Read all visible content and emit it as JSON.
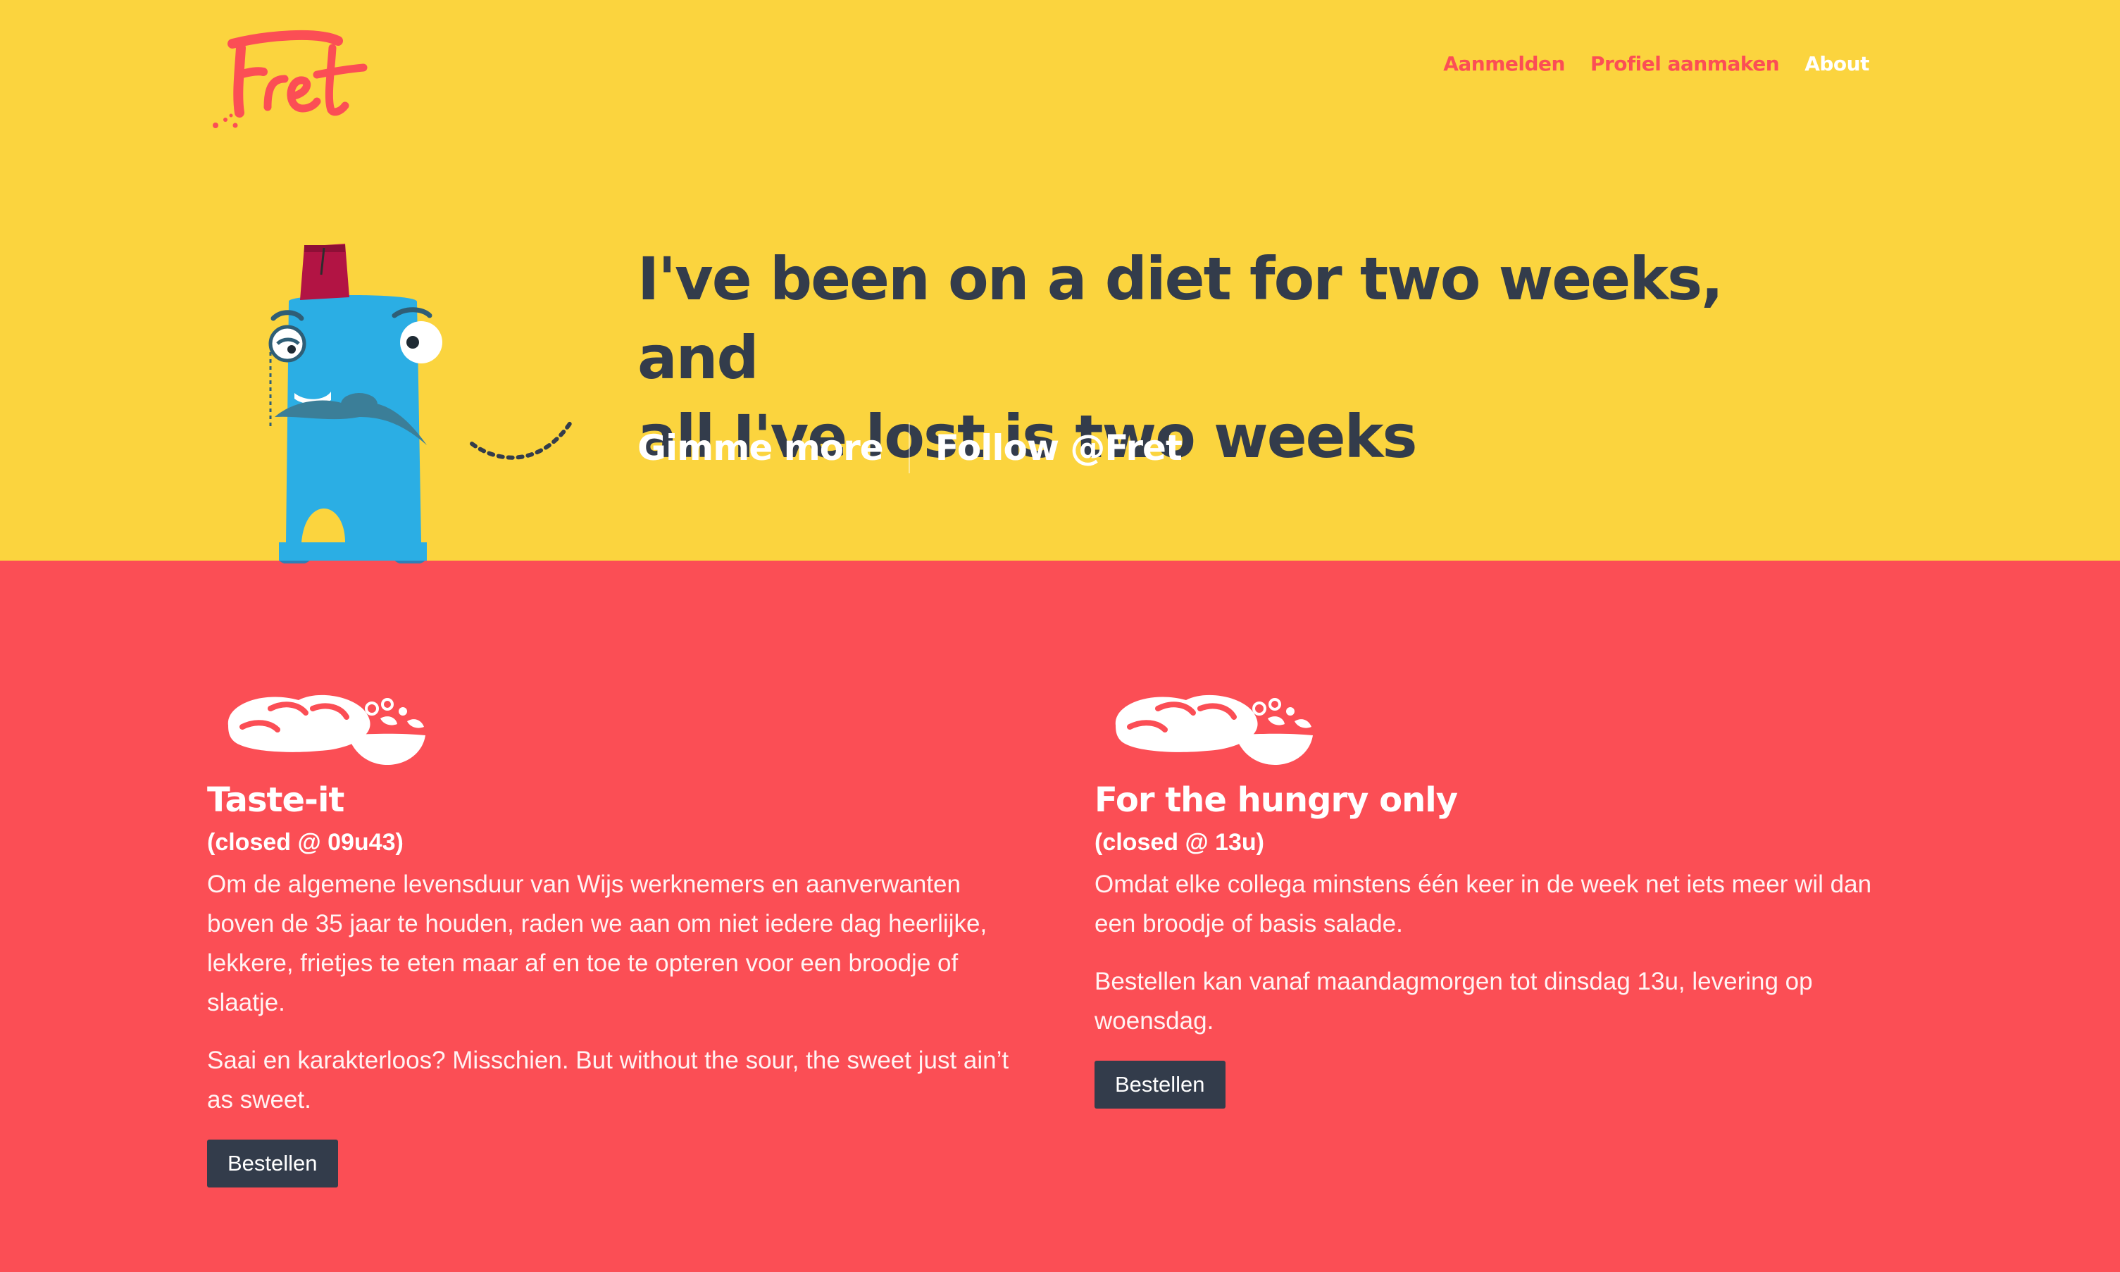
{
  "brand": {
    "logo_text": "Fret",
    "colors": {
      "yellow": "#fbd43e",
      "red": "#fb4e55",
      "dark": "#333c4b",
      "white": "#ffffff"
    }
  },
  "nav": {
    "items": [
      {
        "label": "Aanmelden",
        "color": "#fb4e55"
      },
      {
        "label": "Profiel aanmaken",
        "color": "#fb4e55"
      },
      {
        "label": "About",
        "color": "#ffffff"
      }
    ]
  },
  "hero": {
    "headline_line1": "I've been on a diet for two weeks, and",
    "headline_line2": "all I've lost is two weeks",
    "cta_more": "Gimme more",
    "cta_follow": "Follow @Fret",
    "mascot_icon": "fez-monster-mascot"
  },
  "menus": [
    {
      "icon": "bread-and-salad-icon",
      "title": "Taste-it",
      "status": "(closed @ 09u43)",
      "paragraphs": [
        "Om de algemene levensduur van Wijs werknemers en aanverwanten boven de 35 jaar te houden, raden we aan om niet iedere dag heerlijke, lekkere, frietjes te eten maar af en toe te opteren voor een broodje of slaatje.",
        "Saai en karakterloos? Misschien. But without the sour, the sweet just ain’t as sweet."
      ],
      "button": "Bestellen"
    },
    {
      "icon": "bread-and-salad-icon",
      "title": "For the hungry only",
      "status": "(closed @ 13u)",
      "paragraphs": [
        "Omdat elke collega minstens één keer in de week net iets meer wil dan een broodje of basis salade.",
        "Bestellen kan vanaf maandagmorgen tot dinsdag 13u, levering op woensdag."
      ],
      "button": "Bestellen"
    }
  ]
}
